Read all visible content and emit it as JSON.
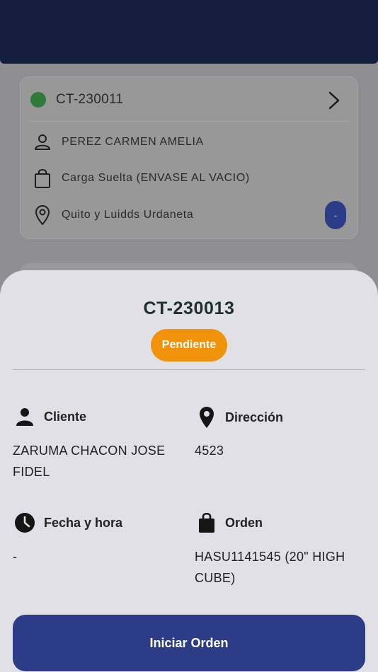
{
  "background": {
    "card": {
      "id": "CT-230011",
      "client": "PEREZ CARMEN AMELIA",
      "cargo": "Carga Suelta (ENVASE AL VACIO)",
      "address": "Quito y Luidds Urdaneta",
      "fab_label": "-",
      "status_color": "#2f7a39"
    }
  },
  "sheet": {
    "title": "CT-230013",
    "status": {
      "label": "Pendiente",
      "color": "#f0930b"
    },
    "fields": {
      "cliente": {
        "label": "Cliente",
        "value": "ZARUMA CHACON JOSE FIDEL",
        "icon": "person-icon"
      },
      "direccion": {
        "label": "Dirección",
        "value": "4523",
        "icon": "location-pin-icon"
      },
      "fecha": {
        "label": "Fecha y hora",
        "value": "-",
        "icon": "clock-icon"
      },
      "orden": {
        "label": "Orden",
        "value": "HASU1141545 (20\" HIGH CUBE)",
        "icon": "shopping-bag-icon"
      }
    },
    "action": {
      "label": "Iniciar Orden",
      "color": "#2d3c86"
    }
  }
}
